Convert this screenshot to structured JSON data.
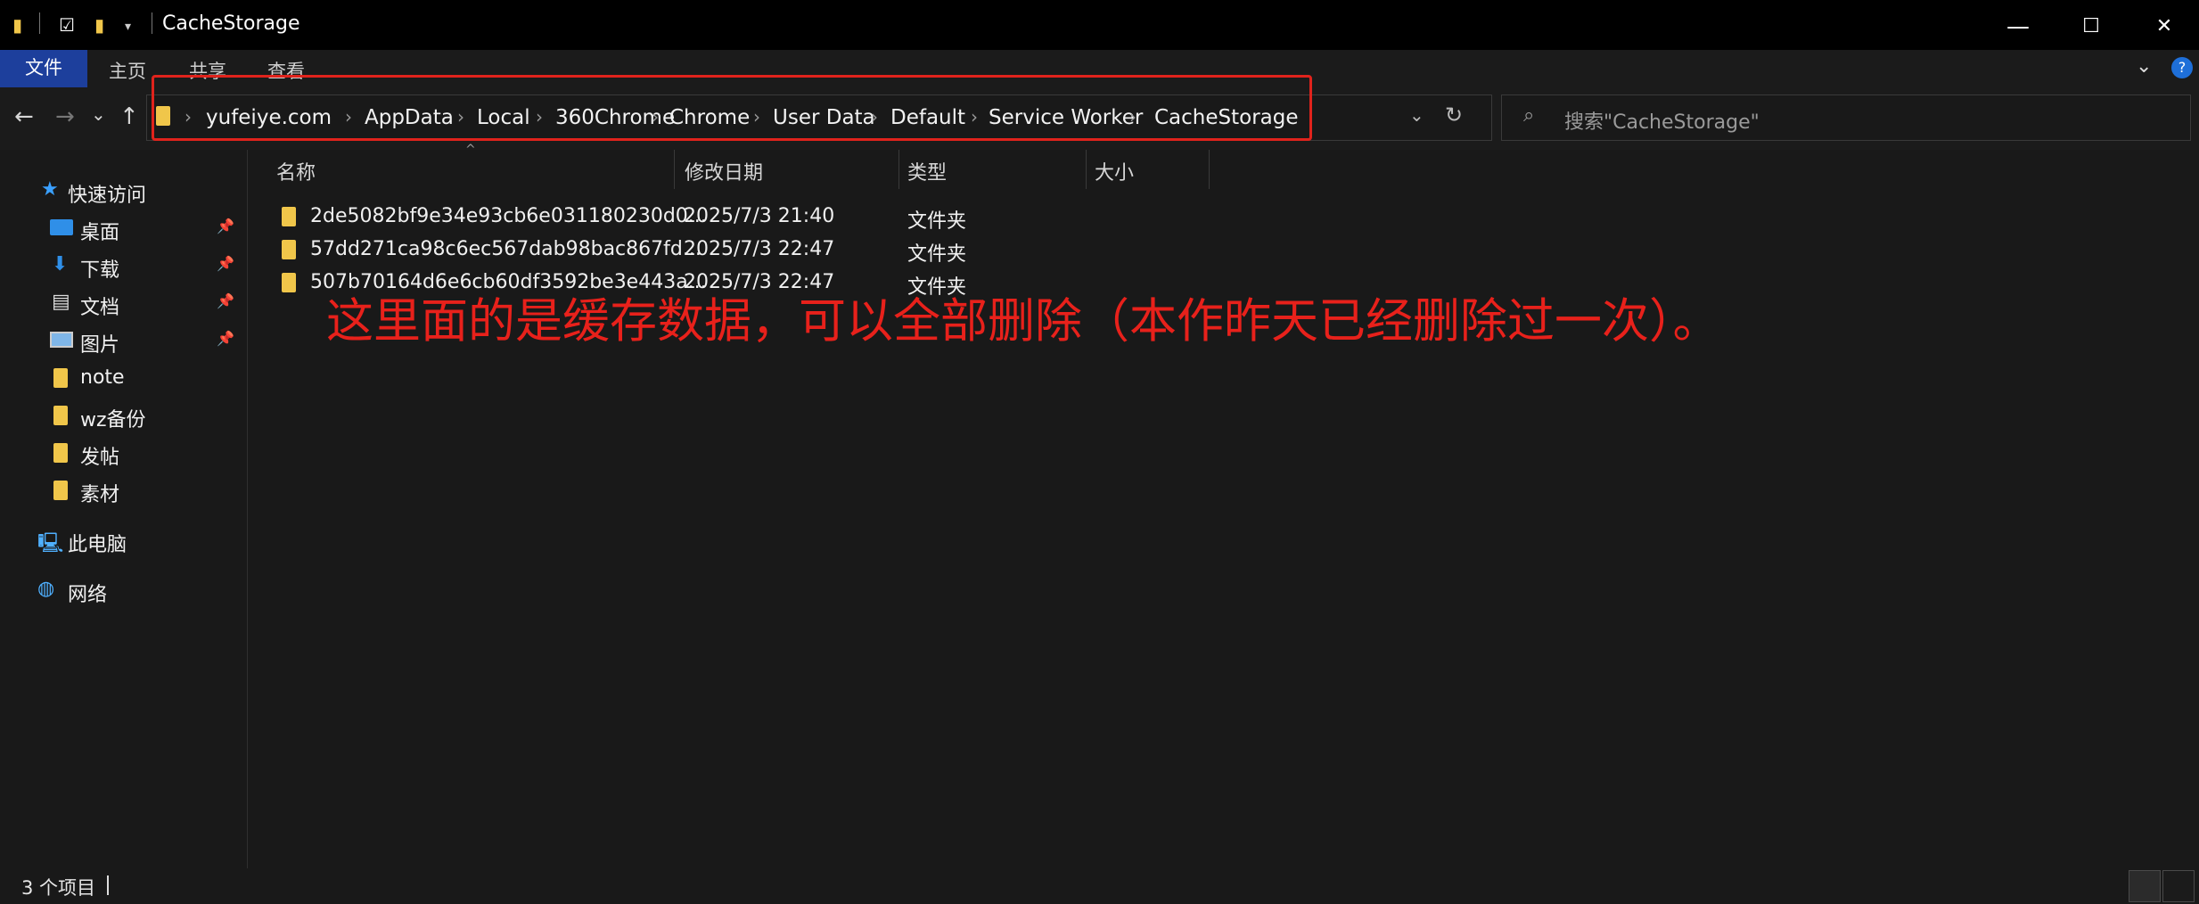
{
  "window": {
    "title": "CacheStorage",
    "controls": {
      "minimize": "—",
      "maximize": "☐",
      "close": "✕"
    }
  },
  "ribbon": {
    "tabs": [
      "文件",
      "主页",
      "共享",
      "查看"
    ],
    "help": "?"
  },
  "nav": {
    "back": "←",
    "forward": "→",
    "recent": "⌄",
    "up": "↑",
    "refresh": "↻",
    "dropdown": "⌄"
  },
  "breadcrumb": [
    "yufeiye.com",
    "AppData",
    "Local",
    "360Chrome",
    "Chrome",
    "User Data",
    "Default",
    "Service Worker",
    "CacheStorage"
  ],
  "search": {
    "placeholder": "搜索\"CacheStorage\""
  },
  "sidebar": {
    "quick_access": "快速访问",
    "items": [
      {
        "label": "桌面",
        "icon": "desktop-icon",
        "pinned": true
      },
      {
        "label": "下载",
        "icon": "download-icon",
        "pinned": true
      },
      {
        "label": "文档",
        "icon": "document-icon",
        "pinned": true
      },
      {
        "label": "图片",
        "icon": "pictures-icon",
        "pinned": true
      },
      {
        "label": "note",
        "icon": "folder-icon",
        "pinned": false
      },
      {
        "label": "wz备份",
        "icon": "folder-icon",
        "pinned": false
      },
      {
        "label": "发帖",
        "icon": "folder-icon",
        "pinned": false
      },
      {
        "label": "素材",
        "icon": "folder-icon",
        "pinned": false
      }
    ],
    "this_pc": "此电脑",
    "network": "网络"
  },
  "columns": [
    "名称",
    "修改日期",
    "类型",
    "大小"
  ],
  "files": [
    {
      "name": "2de5082bf9e34e93cb6e031180230d0...",
      "date": "2025/7/3 21:40",
      "type": "文件夹"
    },
    {
      "name": "57dd271ca98c6ec567dab98bac867fd...",
      "date": "2025/7/3 22:47",
      "type": "文件夹"
    },
    {
      "name": "507b70164d6e6cb60df3592be3e443a...",
      "date": "2025/7/3 22:47",
      "type": "文件夹"
    }
  ],
  "annotation": "这里面的是缓存数据，可以全部删除（本作昨天已经删除过一次）。",
  "status": {
    "item_count": "3 个项目"
  },
  "colors": {
    "accent_tab": "#1d3f9c",
    "annotation_red": "#e8211b",
    "folder": "#f0c64a"
  }
}
